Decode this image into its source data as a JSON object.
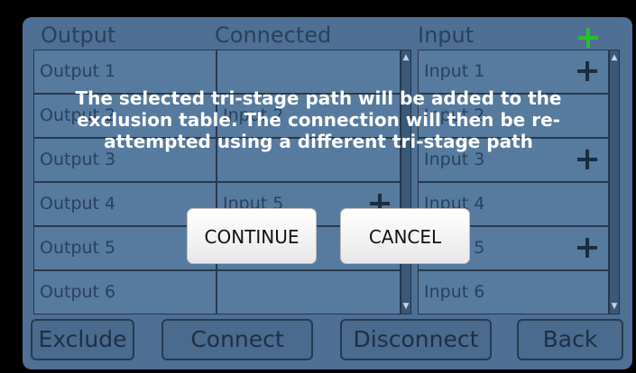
{
  "headers": {
    "output": "Output",
    "connected": "Connected",
    "input": "Input"
  },
  "output_rows": [
    "Output 1",
    "Output 2",
    "Output 3",
    "Output 4",
    "Output 5",
    "Output 6"
  ],
  "connected_rows": [
    "",
    "Input 2",
    "",
    "Input 5",
    "",
    ""
  ],
  "input_rows": [
    "Input 1",
    "Input 2",
    "Input 3",
    "Input 4",
    "Input 5",
    "Input 6"
  ],
  "buttons": {
    "exclude": "Exclude",
    "connect": "Connect",
    "disconnect": "Disconnect",
    "back": "Back"
  },
  "dialog": {
    "message": "The selected tri-stage path will be added to the exclusion table. The connection will then be re-attempted using a different tri-stage path",
    "continue": "CONTINUE",
    "cancel": "CANCEL"
  },
  "colors": {
    "add_icon": "#27c12a",
    "overlay_text": "#ffffff"
  }
}
